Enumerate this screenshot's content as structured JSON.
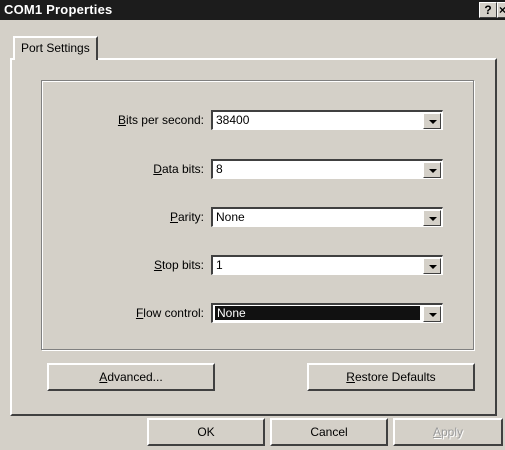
{
  "window": {
    "title": "COM1 Properties",
    "help_glyph": "?",
    "close_glyph": "×"
  },
  "tabs": [
    {
      "label": "Port Settings",
      "selected": true
    }
  ],
  "settings": {
    "bits_per_second": {
      "mnemonic": "B",
      "rest": "its per second:",
      "value": "38400"
    },
    "data_bits": {
      "mnemonic": "D",
      "rest": "ata bits:",
      "value": "8"
    },
    "parity": {
      "mnemonic": "P",
      "rest": "arity:",
      "value": "None"
    },
    "stop_bits": {
      "mnemonic": "S",
      "rest": "top bits:",
      "value": "1"
    },
    "flow_control": {
      "mnemonic": "F",
      "rest": "low control:",
      "value": "None"
    }
  },
  "buttons": {
    "advanced": {
      "mnemonic": "A",
      "rest": "dvanced..."
    },
    "restore_defaults": {
      "mnemonic": "R",
      "rest": "estore Defaults"
    },
    "ok": "OK",
    "cancel": "Cancel",
    "apply": {
      "mnemonic": "A",
      "rest": "pply",
      "enabled": false
    }
  }
}
